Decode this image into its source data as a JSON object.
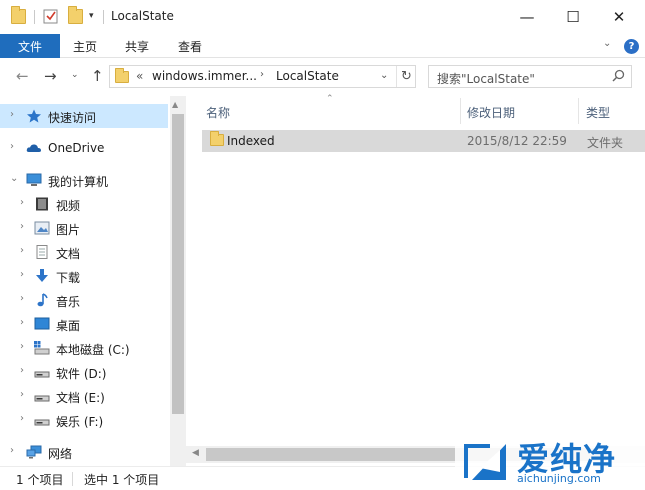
{
  "window": {
    "title": "LocalState",
    "minimize": "—",
    "maximize": "☐",
    "close": "✕"
  },
  "ribbon": {
    "tabs": [
      {
        "label": "文件"
      },
      {
        "label": "主页"
      },
      {
        "label": "共享"
      },
      {
        "label": "查看"
      }
    ],
    "help": "?"
  },
  "address": {
    "overflow": "«",
    "segments": [
      "windows.immer...",
      "LocalState"
    ],
    "separator": "›"
  },
  "search": {
    "placeholder": "搜索\"LocalState\""
  },
  "sidebar": {
    "items": [
      {
        "label": "快速访问",
        "icon": "star-icon"
      },
      {
        "label": "OneDrive",
        "icon": "cloud-icon"
      },
      {
        "label": "我的计算机",
        "icon": "computer-icon"
      },
      {
        "label": "视频",
        "icon": "video-icon"
      },
      {
        "label": "图片",
        "icon": "picture-icon"
      },
      {
        "label": "文档",
        "icon": "document-icon"
      },
      {
        "label": "下载",
        "icon": "download-icon"
      },
      {
        "label": "音乐",
        "icon": "music-icon"
      },
      {
        "label": "桌面",
        "icon": "desktop-icon"
      },
      {
        "label": "本地磁盘 (C:)",
        "icon": "drive-c-icon"
      },
      {
        "label": "软件 (D:)",
        "icon": "drive-icon"
      },
      {
        "label": "文档 (E:)",
        "icon": "drive-icon"
      },
      {
        "label": "娱乐 (F:)",
        "icon": "drive-icon"
      },
      {
        "label": "网络",
        "icon": "network-icon"
      }
    ]
  },
  "table": {
    "columns": [
      "名称",
      "修改日期",
      "类型"
    ],
    "rows": [
      {
        "name": "Indexed",
        "date": "2015/8/12 22:59",
        "type": "文件夹"
      }
    ]
  },
  "status": {
    "count": "1 个项目",
    "selected": "选中 1 个项目"
  },
  "watermark": {
    "cn": "爱纯净",
    "en": "aichunjing.com"
  },
  "colors": {
    "accent": "#1f6dbd",
    "selected_bg": "#cce8ff",
    "row_selected_bg": "#d9d9d9",
    "folder": "#f3d06b"
  }
}
